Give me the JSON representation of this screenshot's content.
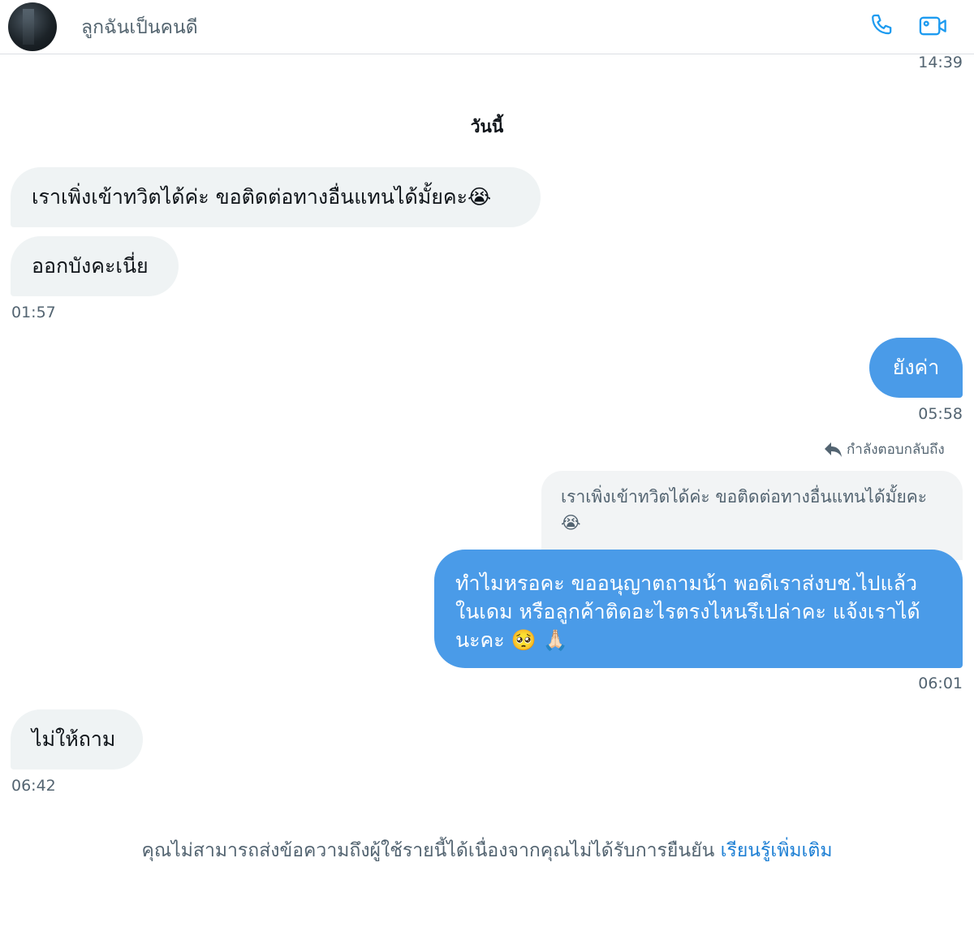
{
  "header": {
    "contact_name": "ลูกฉันเป็นคนดี",
    "phone_icon": "phone-icon",
    "video_icon": "video-camera-icon",
    "accent": "#1d9bf0"
  },
  "earlier_timestamp": "14:39",
  "day_divider": "วันนี้",
  "messages": [
    {
      "direction": "incoming",
      "text": "เราเพิ่งเข้าทวิตได้ค่ะ ขอติดต่อทางอื่นแทนได้มั้ยคะ😭"
    },
    {
      "direction": "incoming",
      "text": "ออกบังคะเนี่ย",
      "time": "01:57"
    },
    {
      "direction": "outgoing",
      "text": "ยังค่า",
      "time": "05:58"
    },
    {
      "direction": "outgoing",
      "reply_label": "กำลังตอบกลับถึง",
      "quoted_text": "เราเพิ่งเข้าทวิตได้ค่ะ ขอติดต่อทางอื่นแทนได้มั้ยคะ 😭",
      "lines": [
        "ทำไมหรอคะ ขออนุญาตถามน้า พอดีเราส่งบช.ไปแล้ว",
        "ในเดม หรือลูกค้าติดอะไรตรงไหนรึเปล่าคะ แจ้งเราได้",
        "นะคะ 🥺 🙏🏻"
      ],
      "time": "06:01"
    },
    {
      "direction": "incoming",
      "text": "ไม่ให้ถาม",
      "time": "06:42"
    }
  ],
  "footer": {
    "notice": "คุณไม่สามารถส่งข้อความถึงผู้ใช้รายนี้ได้เนื่องจากคุณไม่ได้รับการยืนยัน",
    "learn_more": "เรียนรู้เพิ่มเติม"
  },
  "colors": {
    "outgoing_bubble": "#4a9be8",
    "incoming_bubble": "#eff3f4",
    "link": "#1d7fd4"
  }
}
